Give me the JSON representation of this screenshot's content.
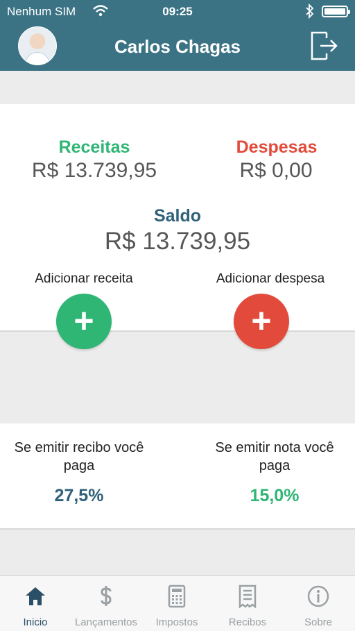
{
  "status_bar": {
    "carrier": "Nenhum SIM",
    "time": "09:25"
  },
  "header": {
    "user_name": "Carlos Chagas",
    "avatar_icon": "doctor-avatar",
    "logout_icon": "logout-icon",
    "background_color": "#3b7385"
  },
  "summary": {
    "income_label": "Receitas",
    "income_value": "R$ 13.739,95",
    "expense_label": "Despesas",
    "expense_value": "R$ 0,00",
    "balance_label": "Saldo",
    "balance_value": "R$ 13.739,95",
    "add_income_label": "Adicionar receita",
    "add_expense_label": "Adicionar despesa",
    "add_icon": "+",
    "colors": {
      "income": "#2fb574",
      "expense": "#e24b3b",
      "balance": "#2f6179"
    }
  },
  "taxes": {
    "receipt_text": "Se emitir recibo você paga",
    "receipt_value": "27,5%",
    "invoice_text": "Se emitir nota você paga",
    "invoice_value": "15,0%"
  },
  "tabs": [
    {
      "label": "Inicio",
      "icon": "home-icon",
      "active": true
    },
    {
      "label": "Lançamentos",
      "icon": "dollar-icon",
      "active": false
    },
    {
      "label": "Impostos",
      "icon": "calculator-icon",
      "active": false
    },
    {
      "label": "Recibos",
      "icon": "receipt-icon",
      "active": false
    },
    {
      "label": "Sobre",
      "icon": "info-icon",
      "active": false
    }
  ]
}
